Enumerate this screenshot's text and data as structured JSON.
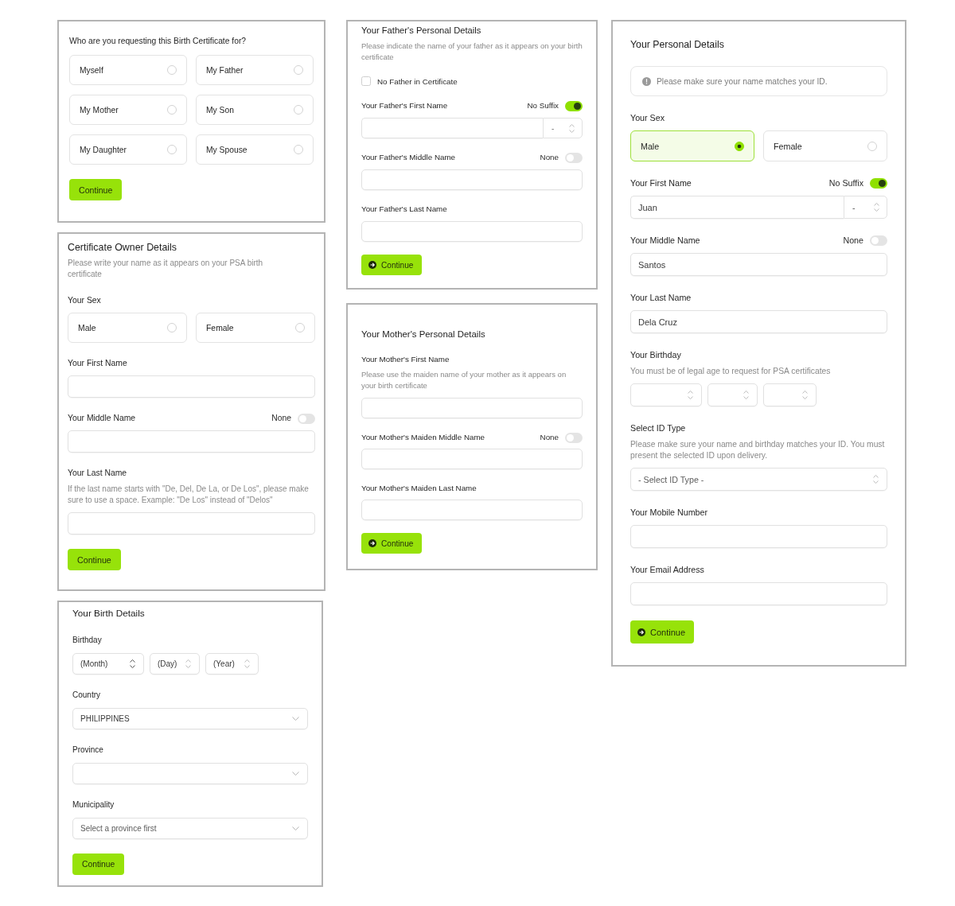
{
  "columns": [
    {
      "cards": [
        {
          "blocks": [
            {
              "kind": "choices",
              "label": "Who are you requesting this Birth Certificate for?",
              "options": [
                {
                  "label": "Myself",
                  "selected": false
                },
                {
                  "label": "My Father",
                  "selected": false
                },
                {
                  "label": "My Mother",
                  "selected": false
                },
                {
                  "label": "My Son",
                  "selected": false
                },
                {
                  "label": "My Daughter",
                  "selected": false
                },
                {
                  "label": "My Spouse",
                  "selected": false
                }
              ]
            }
          ],
          "button": {
            "label": "Continue"
          }
        },
        {
          "title": "Certificate Owner Details",
          "description": "Please write your name as it appears on your PSA birth certificate",
          "blocks": [
            {
              "kind": "choices",
              "label": "Your Sex",
              "options": [
                {
                  "label": "Male",
                  "selected": false
                },
                {
                  "label": "Female",
                  "selected": false
                }
              ]
            },
            {
              "kind": "text",
              "label": "Your First Name"
            },
            {
              "kind": "text",
              "label": "Your Middle Name",
              "toggle": {
                "label": "None",
                "on": false
              }
            },
            {
              "kind": "text",
              "label": "Your Last Name",
              "hint": "If the last name starts with \"De, Del, De La, or De Los\", please make sure to use a space. Example: \"De Los\" instead of \"Delos\""
            }
          ],
          "button": {
            "label": "Continue"
          }
        },
        {
          "title": "Your Birth Details",
          "blocks": [
            {
              "kind": "date",
              "label": "Birthday",
              "parts": [
                {
                  "kind": "month",
                  "value": "(Month)"
                },
                {
                  "kind": "day",
                  "value": "(Day)"
                },
                {
                  "kind": "year",
                  "value": "(Year)"
                }
              ]
            },
            {
              "kind": "select",
              "label": "Country",
              "value": "PHILIPPINES"
            },
            {
              "kind": "select",
              "label": "Province"
            },
            {
              "kind": "select",
              "label": "Municipality",
              "placeholder": "Select a province first"
            }
          ],
          "button": {
            "label": "Continue"
          }
        }
      ]
    },
    {
      "cards": [
        {
          "title": "Your Father's Personal Details",
          "description": "Please indicate the name of your father as it appears on your birth certificate",
          "blocks": [
            {
              "kind": "checkbox",
              "label": "No Father in Certificate",
              "checked": false
            },
            {
              "kind": "text",
              "label": "Your Father's First Name",
              "toggle": {
                "label": "No Suffix",
                "on": true
              },
              "suffix": "-"
            },
            {
              "kind": "text",
              "label": "Your Father's Middle Name",
              "toggle": {
                "label": "None",
                "on": false
              }
            },
            {
              "kind": "text",
              "label": "Your Father's Last Name"
            }
          ],
          "button": {
            "label": "Continue",
            "icon": true
          }
        },
        {
          "title": "Your Mother's Personal Details",
          "blocks": [
            {
              "kind": "text",
              "label": "Your Mother's First Name",
              "hint": "Please use the maiden name of your mother as it appears on your birth certificate"
            },
            {
              "kind": "text",
              "label": "Your Mother's Maiden Middle Name",
              "toggle": {
                "label": "None",
                "on": false
              }
            },
            {
              "kind": "text",
              "label": "Your Mother's Maiden Last Name"
            }
          ],
          "button": {
            "label": "Continue",
            "icon": true
          }
        }
      ]
    },
    {
      "cards": [
        {
          "title": "Your Personal Details",
          "blocks": [
            {
              "kind": "notice",
              "text": "Please make sure your name matches your ID."
            },
            {
              "kind": "choices",
              "label": "Your Sex",
              "options": [
                {
                  "label": "Male",
                  "selected": true
                },
                {
                  "label": "Female",
                  "selected": false
                }
              ]
            },
            {
              "kind": "text",
              "label": "Your First Name",
              "toggle": {
                "label": "No Suffix",
                "on": true
              },
              "value": "Juan",
              "suffix": "-"
            },
            {
              "kind": "text",
              "label": "Your Middle Name",
              "toggle": {
                "label": "None",
                "on": false
              },
              "value": "Santos"
            },
            {
              "kind": "text",
              "label": "Your Last Name",
              "value": "Dela Cruz"
            },
            {
              "kind": "date",
              "label": "Your Birthday",
              "hint": "You must be of legal age to request for PSA certificates",
              "parts": [
                {
                  "kind": "month"
                },
                {
                  "kind": "day"
                },
                {
                  "kind": "year"
                }
              ]
            },
            {
              "kind": "select_updown",
              "label": "Select ID Type",
              "hint": "Please make sure your name and birthday matches your ID. You must present the selected ID upon delivery.",
              "placeholder": "- Select ID Type -"
            },
            {
              "kind": "text",
              "label": "Your Mobile Number"
            },
            {
              "kind": "text",
              "label": "Your Email Address"
            }
          ],
          "button": {
            "label": "Continue",
            "icon": true
          }
        }
      ]
    }
  ]
}
